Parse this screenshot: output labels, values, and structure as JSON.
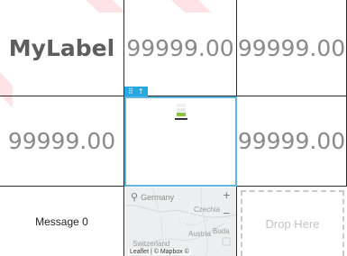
{
  "grid": {
    "row1": {
      "label": "MyLabel",
      "value1": "99999.00",
      "value2": "99999.00"
    },
    "row2": {
      "value1": "99999.00",
      "value3": "99999.00"
    },
    "row3": {
      "message": "Message 0",
      "drop_label": "Drop Here"
    }
  },
  "selection_toolbar": {
    "move_icon": "drag-handle-icon",
    "up_icon": "arrow-up-icon"
  },
  "map": {
    "search_text": "Germany",
    "places": {
      "czechia": "Czechia",
      "austria": "Austria",
      "buda": "Buda",
      "switzerland": "Switzerland"
    },
    "zoom_in": "+",
    "zoom_out": "−",
    "attribution": "Leaflet | © Mapbox ©"
  },
  "colors": {
    "selection": "#5fb6e0",
    "toolbar": "#26a8e0",
    "bar_green": "#8ac43f",
    "bar_dark": "#333333"
  }
}
